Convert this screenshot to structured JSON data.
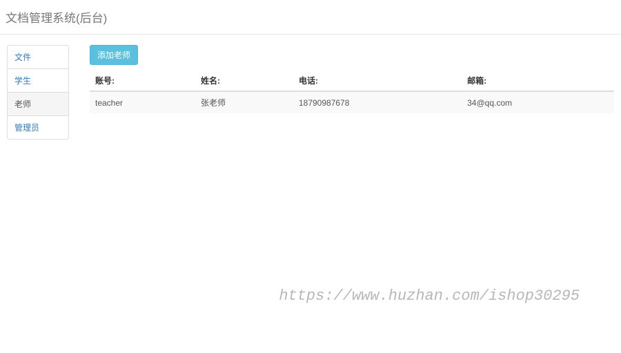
{
  "header": {
    "title": "文档管理系统(后台)"
  },
  "sidebar": {
    "items": [
      {
        "label": "文件",
        "active": false
      },
      {
        "label": "学生",
        "active": false
      },
      {
        "label": "老师",
        "active": true
      },
      {
        "label": "管理员",
        "active": false
      }
    ]
  },
  "main": {
    "add_button_label": "添加老师",
    "table": {
      "headers": [
        "账号:",
        "姓名:",
        "电话:",
        "邮箱:"
      ],
      "rows": [
        {
          "account": "teacher",
          "name": "张老师",
          "phone": "18790987678",
          "email": "34@qq.com"
        }
      ]
    }
  },
  "watermark": "https://www.huzhan.com/ishop30295"
}
